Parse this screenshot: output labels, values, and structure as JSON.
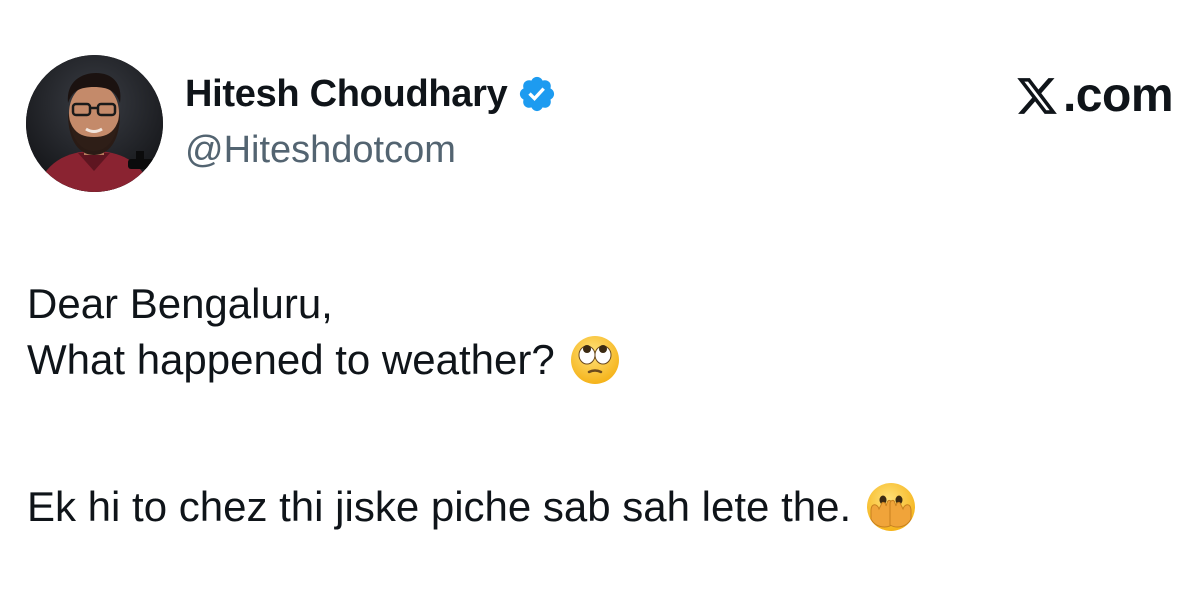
{
  "author": {
    "display_name": "Hitesh Choudhary",
    "handle": "@Hiteshdotcom",
    "verified": true,
    "verified_color": "#1d9bf0",
    "avatar_icon": "profile-photo"
  },
  "brand": {
    "logo_icon": "x-logo-icon",
    "text": ".com"
  },
  "tweet": {
    "line1": "Dear Bengaluru,",
    "line2": "What happened to weather?",
    "line2_emoji": "face-with-rolling-eyes-emoji",
    "line3": "Ek hi to chez thi jiske piche sab sah lete the.",
    "line3_emoji": "face-with-open-eyes-and-hand-over-mouth-emoji"
  },
  "colors": {
    "text_primary": "#0f1419",
    "text_secondary": "#536471",
    "background": "#ffffff"
  }
}
